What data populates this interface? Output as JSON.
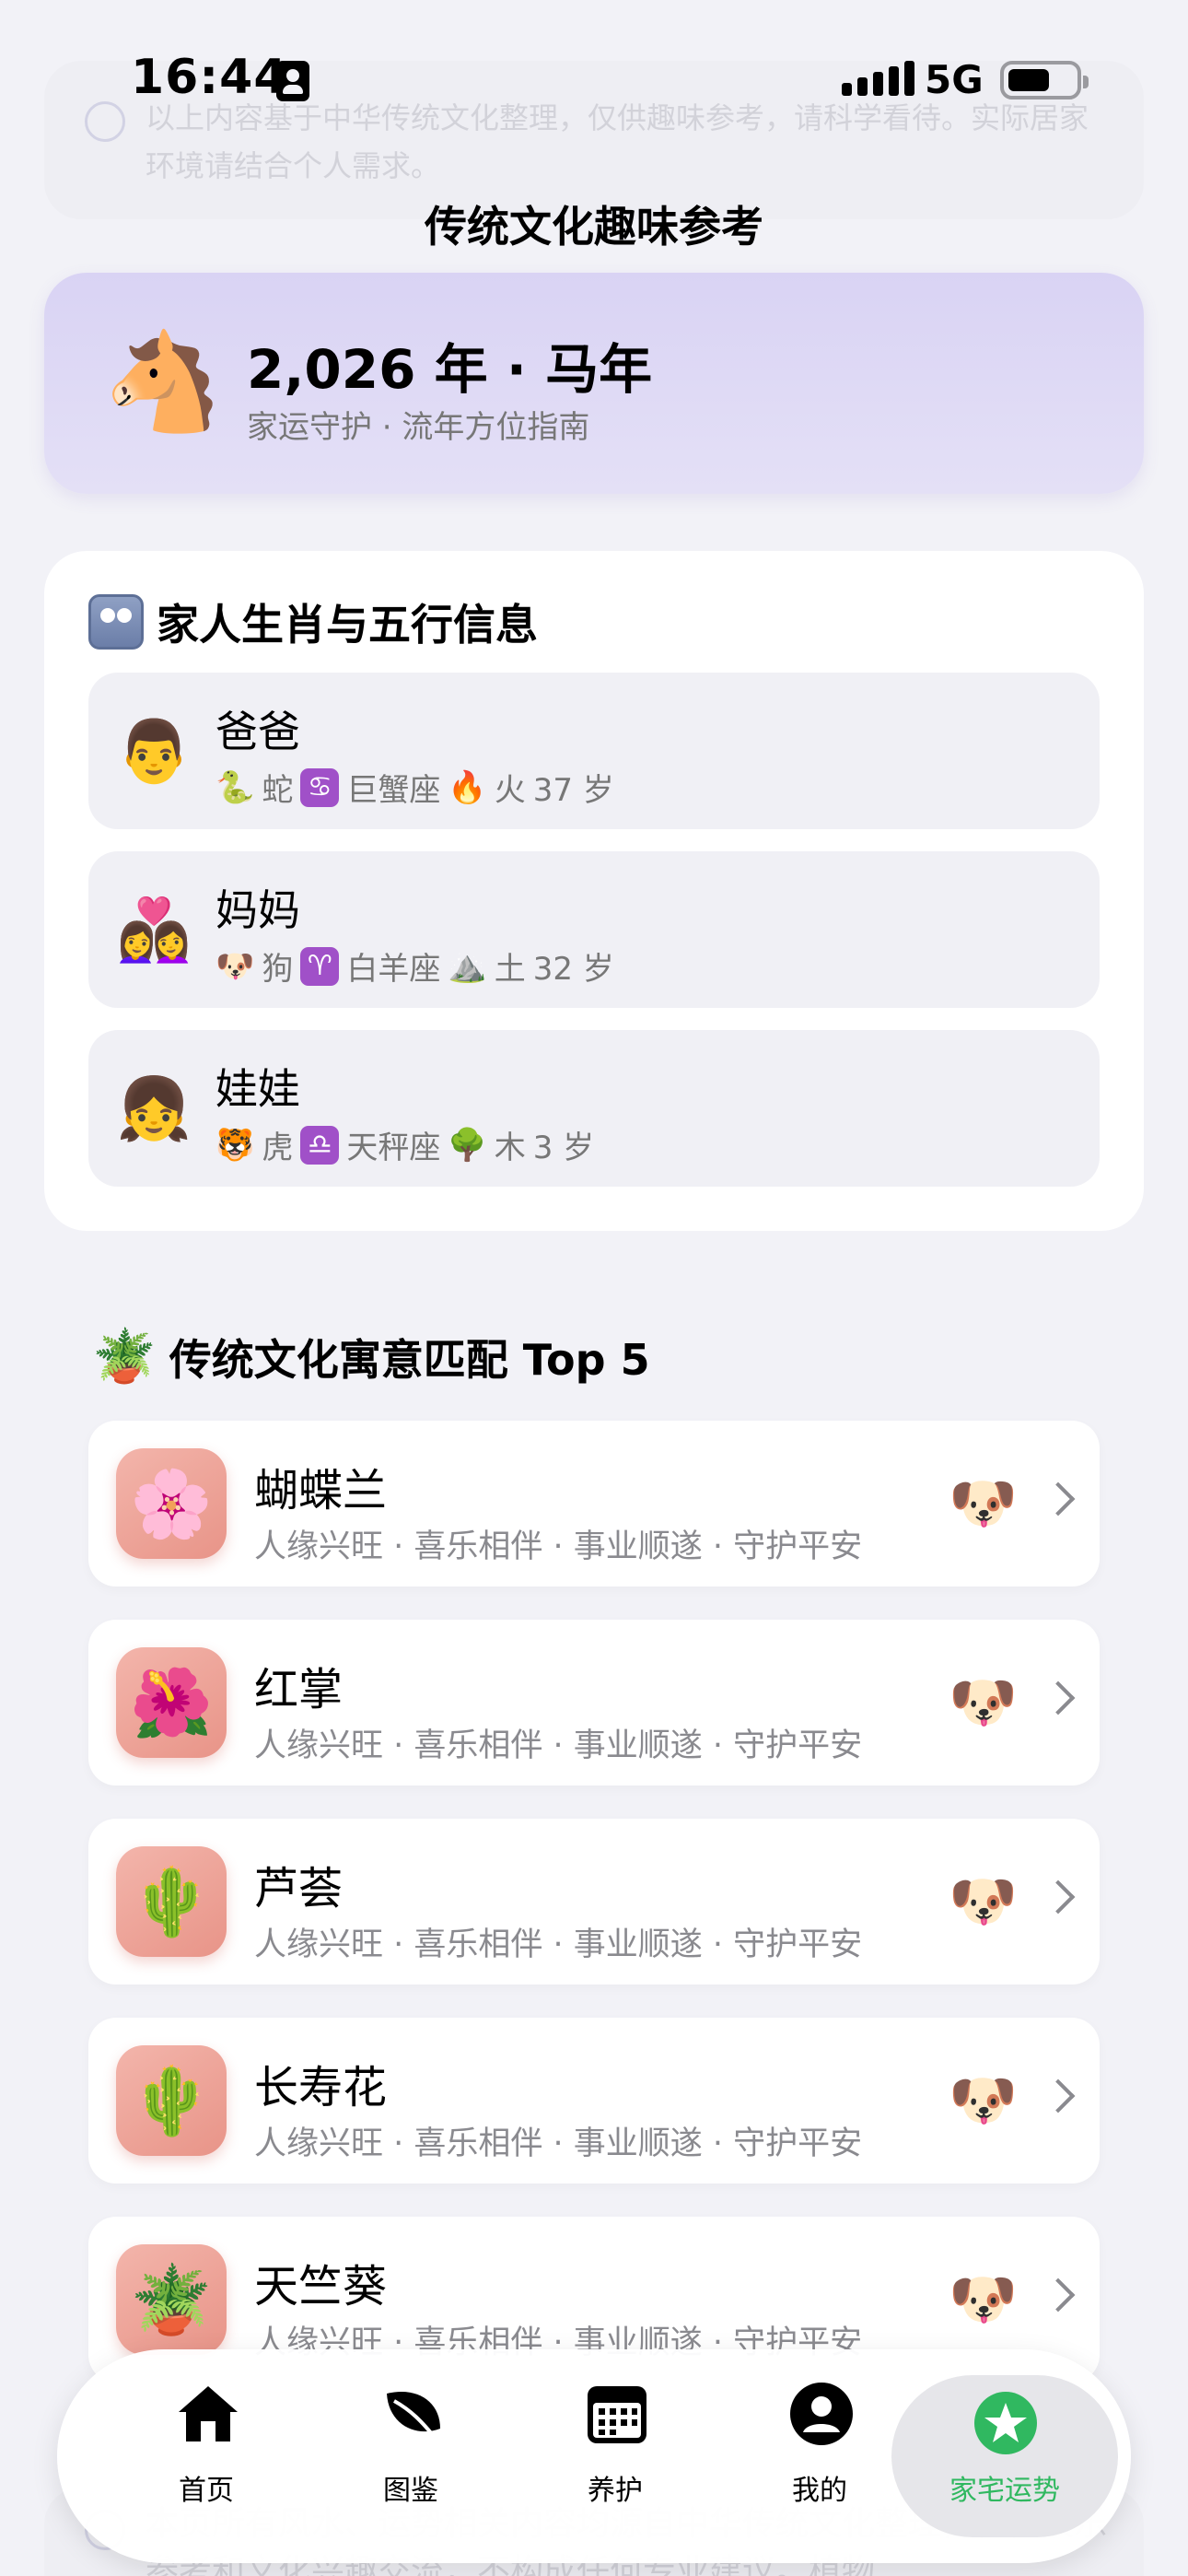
{
  "status_bar": {
    "time": "16:44",
    "network": "5G"
  },
  "page_title": "传统文化趣味参考",
  "hero": {
    "title": "2,026 年 · 马年",
    "subtitle": "家运守护 · 流年方位指南"
  },
  "family": {
    "heading": "家人生肖与五行信息",
    "members": [
      {
        "name": "爸爸",
        "zodiac_animal": "蛇",
        "star_sign": "巨蟹座",
        "star_symbol": "♋",
        "element": "火",
        "age": "37 岁"
      },
      {
        "name": "妈妈",
        "zodiac_animal": "狗",
        "star_sign": "白羊座",
        "star_symbol": "♈",
        "element": "土",
        "age": "32 岁"
      },
      {
        "name": "娃娃",
        "zodiac_animal": "虎",
        "star_sign": "天秤座",
        "star_symbol": "♎",
        "element": "木",
        "age": "3 岁"
      }
    ]
  },
  "plants": {
    "heading": "传统文化寓意匹配 Top 5",
    "items": [
      {
        "name": "蝴蝶兰",
        "desc": "人缘兴旺 · 喜乐相伴 · 事业顺遂 · 守护平安"
      },
      {
        "name": "红掌",
        "desc": "人缘兴旺 · 喜乐相伴 · 事业顺遂 · 守护平安"
      },
      {
        "name": "芦荟",
        "desc": "人缘兴旺 · 喜乐相伴 · 事业顺遂 · 守护平安"
      },
      {
        "name": "长寿花",
        "desc": "人缘兴旺 · 喜乐相伴 · 事业顺遂 · 守护平安"
      },
      {
        "name": "天竺葵",
        "desc": "人缘兴旺 · 喜乐相伴 · 事业顺遂 · 守护平安"
      }
    ]
  },
  "ghost_top_text": "以上内容基于中华传统文化整理，仅供趣味参考，请科学看待。实际居家环境请结合个人需求。",
  "ghost_bottom_text": "本页所有风水、运势相关内容均源自中华传统文化整理，仅供娱乐参考和文化兴趣交流，不构成任何专业建议。植物",
  "tabbar": {
    "tabs": [
      {
        "label": "首页",
        "icon": "house-icon"
      },
      {
        "label": "图鉴",
        "icon": "leaf-icon"
      },
      {
        "label": "养护",
        "icon": "calendar-icon"
      },
      {
        "label": "我的",
        "icon": "person-icon"
      },
      {
        "label": "家宅运势",
        "icon": "star-badge-icon"
      }
    ],
    "active": "家宅运势",
    "accent_color": "#30b860"
  }
}
